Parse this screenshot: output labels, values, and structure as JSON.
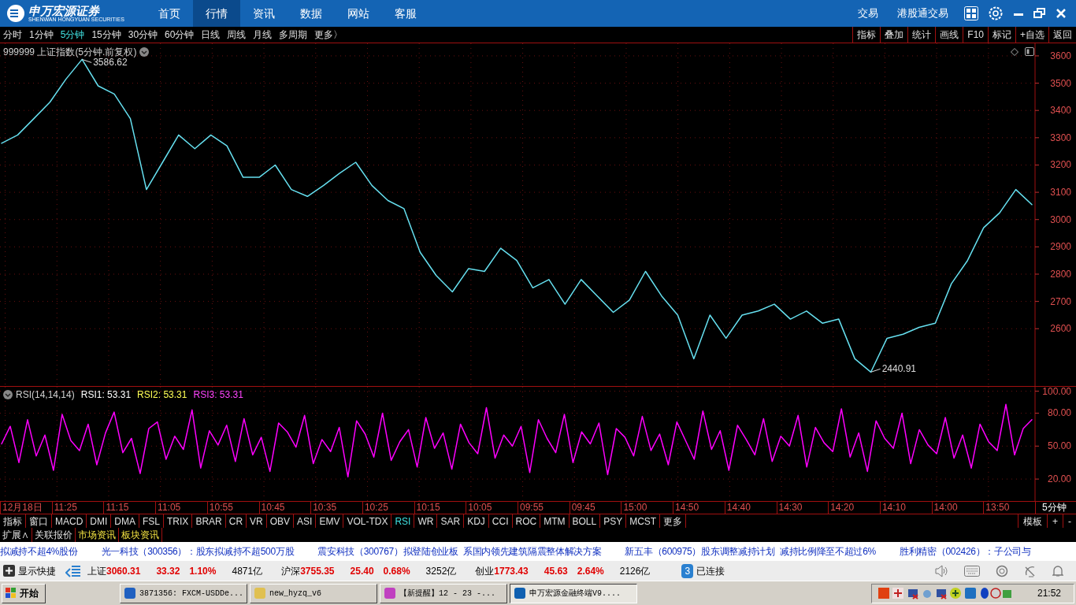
{
  "header": {
    "logo_text": "申万宏源证券",
    "logo_subtext": "SHENWAN HONGYUAN SECURITIES",
    "nav": [
      {
        "label": "首页",
        "selected": false
      },
      {
        "label": "行情",
        "selected": true
      },
      {
        "label": "资讯",
        "selected": false
      },
      {
        "label": "数据",
        "selected": false
      },
      {
        "label": "网站",
        "selected": false
      },
      {
        "label": "客服",
        "selected": false
      }
    ],
    "links": [
      "交易",
      "港股通交易"
    ]
  },
  "periods": [
    {
      "label": "分时",
      "selected": false
    },
    {
      "label": "1分钟",
      "selected": false
    },
    {
      "label": "5分钟",
      "selected": true
    },
    {
      "label": "15分钟",
      "selected": false
    },
    {
      "label": "30分钟",
      "selected": false
    },
    {
      "label": "60分钟",
      "selected": false
    },
    {
      "label": "日线",
      "selected": false
    },
    {
      "label": "周线",
      "selected": false
    },
    {
      "label": "月线",
      "selected": false
    },
    {
      "label": "多周期",
      "selected": false
    },
    {
      "label": "更多〉",
      "selected": false
    }
  ],
  "tools": [
    "指标",
    "叠加",
    "统计",
    "画线",
    "F10",
    "标记",
    "+自选",
    "返回"
  ],
  "main_chart": {
    "title": "999999 上证指数(5分钟.前复权)",
    "chart_data": {
      "type": "line",
      "series": [
        {
          "color": "#66e0f0",
          "values": [
            3280,
            3310,
            3370,
            3430,
            3515,
            3587,
            3490,
            3460,
            3370,
            3110,
            3210,
            3310,
            3260,
            3310,
            3270,
            3155,
            3155,
            3200,
            3110,
            3085,
            3125,
            3170,
            3210,
            3125,
            3070,
            3040,
            2880,
            2795,
            2735,
            2820,
            2810,
            2895,
            2850,
            2750,
            2780,
            2690,
            2780,
            2720,
            2660,
            2705,
            2810,
            2720,
            2650,
            2490,
            2650,
            2565,
            2650,
            2665,
            2690,
            2635,
            2665,
            2620,
            2635,
            2490,
            2441,
            2565,
            2580,
            2605,
            2620,
            2765,
            2850,
            2970,
            3025,
            3110,
            3055
          ]
        }
      ],
      "ylim": [
        2390,
        3646
      ],
      "grid": true,
      "yticks": [
        {
          "value": 2600,
          "label": "2600"
        },
        {
          "value": 2700,
          "label": "2700"
        },
        {
          "value": 2800,
          "label": "2800"
        },
        {
          "value": 2900,
          "label": "2900"
        },
        {
          "value": 3000,
          "label": "3000"
        },
        {
          "value": 3100,
          "label": "3100"
        },
        {
          "value": 3200,
          "label": "3200"
        },
        {
          "value": 3300,
          "label": "3300"
        },
        {
          "value": 3400,
          "label": "3400"
        },
        {
          "value": 3500,
          "label": "3500"
        },
        {
          "value": 3600,
          "label": "3600"
        }
      ],
      "annotations": [
        "3586.62",
        "2440.91"
      ]
    }
  },
  "rsi_chart": {
    "title": "RSI(14,14,14)",
    "readings": [
      {
        "label": "RSI1: 53.31",
        "color": "#ffffff"
      },
      {
        "label": "RSI2: 53.31",
        "color": "#ffff55"
      },
      {
        "label": "RSI3: 53.31",
        "color": "#ff44ff"
      }
    ],
    "chart_data": {
      "type": "line",
      "grid": true,
      "ylim": [
        0,
        104
      ],
      "yticks": [
        {
          "value": 20,
          "label": "20.00"
        },
        {
          "value": 50,
          "label": "50.00"
        },
        {
          "value": 80,
          "label": "80.00"
        },
        {
          "value": 100,
          "label": "100.00"
        }
      ],
      "series": [
        {
          "color": "#ff00ff",
          "values": [
            52,
            68,
            35,
            74,
            41,
            60,
            28,
            79,
            55,
            46,
            70,
            33,
            62,
            81,
            44,
            57,
            25,
            66,
            72,
            38,
            59,
            47,
            83,
            30,
            64,
            51,
            69,
            36,
            75,
            42,
            58,
            27,
            71,
            63,
            49,
            78,
            34,
            56,
            45,
            67,
            22,
            73,
            61,
            40,
            80,
            37,
            54,
            65,
            31,
            76,
            48,
            62,
            29,
            70,
            53,
            43,
            85,
            39,
            60,
            50,
            68,
            26,
            74,
            57,
            44,
            79,
            35,
            63,
            52,
            71,
            24,
            66,
            58,
            41,
            77,
            46,
            61,
            33,
            72,
            55,
            38,
            82,
            47,
            64,
            28,
            69,
            56,
            42,
            75,
            36,
            59,
            50,
            78,
            31,
            67,
            53,
            45,
            84,
            40,
            62,
            27,
            73,
            57,
            48,
            80,
            34,
            65,
            51,
            43,
            76,
            39,
            60,
            30,
            70,
            54,
            46,
            88,
            42,
            66,
            74
          ]
        }
      ]
    }
  },
  "time_axis": [
    "12月18日",
    "11:25",
    "11:15",
    "11:05",
    "10:55",
    "10:45",
    "10:35",
    "10:25",
    "10:15",
    "10:05",
    "09:55",
    "09:45",
    "15:00",
    "14:50",
    "14:40",
    "14:30",
    "14:20",
    "14:10",
    "14:00",
    "13:50"
  ],
  "period_label": "5分钟",
  "indicators": [
    {
      "label": "指标",
      "selected": false
    },
    {
      "label": "窗口",
      "selected": false
    },
    {
      "label": "MACD",
      "selected": false
    },
    {
      "label": "DMI",
      "selected": false
    },
    {
      "label": "DMA",
      "selected": false
    },
    {
      "label": "FSL",
      "selected": false
    },
    {
      "label": "TRIX",
      "selected": false
    },
    {
      "label": "BRAR",
      "selected": false
    },
    {
      "label": "CR",
      "selected": false
    },
    {
      "label": "VR",
      "selected": false
    },
    {
      "label": "OBV",
      "selected": false
    },
    {
      "label": "ASI",
      "selected": false
    },
    {
      "label": "EMV",
      "selected": false
    },
    {
      "label": "VOL-TDX",
      "selected": false
    },
    {
      "label": "RSI",
      "selected": true
    },
    {
      "label": "WR",
      "selected": false
    },
    {
      "label": "SAR",
      "selected": false
    },
    {
      "label": "KDJ",
      "selected": false
    },
    {
      "label": "CCI",
      "selected": false
    },
    {
      "label": "ROC",
      "selected": false
    },
    {
      "label": "MTM",
      "selected": false
    },
    {
      "label": "BOLL",
      "selected": false
    },
    {
      "label": "PSY",
      "selected": false
    },
    {
      "label": "MCST",
      "selected": false
    },
    {
      "label": "更多",
      "selected": false
    }
  ],
  "indicator_right": [
    "模板",
    "+",
    "-"
  ],
  "bottom_tabs": [
    {
      "label": "扩展∧",
      "highlighted": false
    },
    {
      "label": "关联报价",
      "highlighted": false
    },
    {
      "label": "市场资讯",
      "highlighted": true
    },
    {
      "label": "板块资讯",
      "highlighted": true
    }
  ],
  "news": [
    "拟减持不超4%股份",
    "光一科技（300356）：股东拟减持不超500万股",
    "震安科技（300767）拟登陆创业板  系国内领先建筑隔震整体解决方案",
    "新五丰（600975）股东调整减持计划  减持比例降至不超过6%",
    "胜利精密（002426）：子公司与"
  ],
  "status": {
    "shortcut": "显示快捷",
    "indices": [
      {
        "name": "上证",
        "value": "3060.31",
        "change": "33.32",
        "percent": "1.10%",
        "amount": "4871亿"
      },
      {
        "name": "沪深",
        "value": "3755.35",
        "change": "25.40",
        "percent": "0.68%",
        "amount": "3252亿"
      },
      {
        "name": "创业",
        "value": "1773.43",
        "change": "45.63",
        "percent": "2.64%",
        "amount": "2126亿"
      }
    ],
    "connection_count": "3",
    "connection": "已连接"
  },
  "taskbar": {
    "start": "开始",
    "tasks": [
      {
        "label": "3871356: FXCM-USDDe...",
        "selected": false
      },
      {
        "label": "new_hyzq_v6",
        "selected": false
      },
      {
        "label": "【新提醒】12 - 23 -...",
        "selected": false
      },
      {
        "label": "申万宏源金融终端V9....",
        "selected": true
      }
    ],
    "clock": "21:52"
  }
}
